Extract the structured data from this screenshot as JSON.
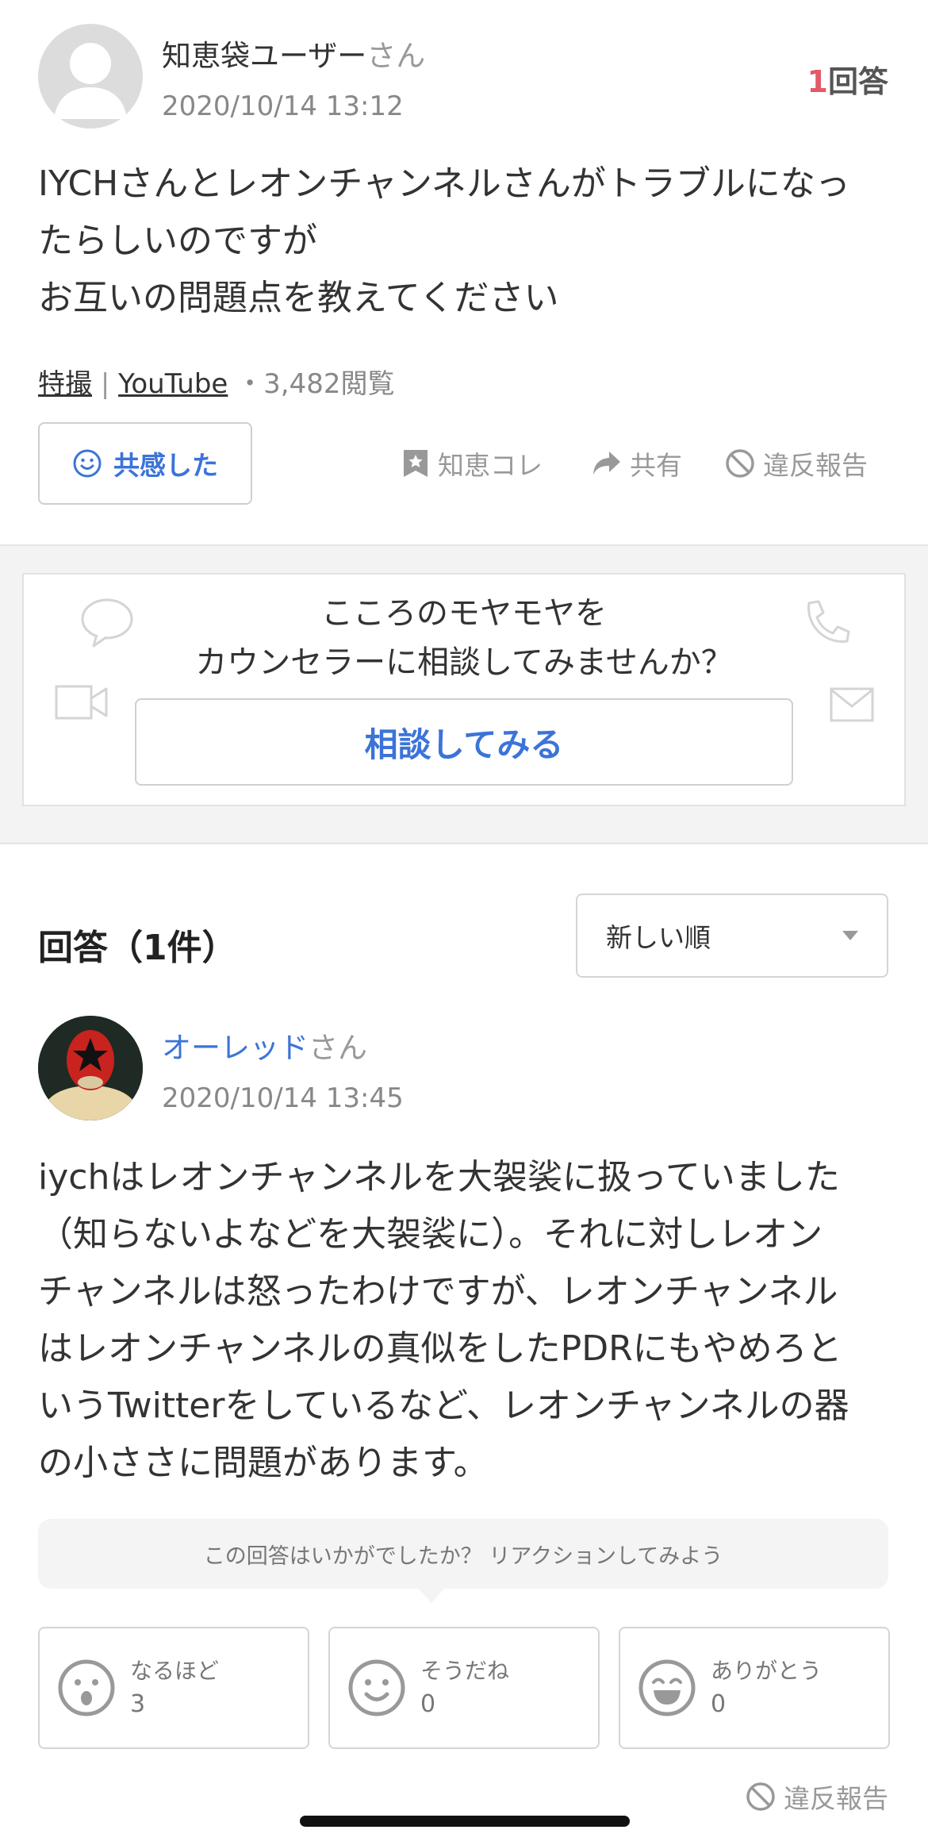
{
  "question": {
    "user_name": "知恵袋ユーザー",
    "user_suffix": "さん",
    "date": "2020/10/14 13:12",
    "answer_count_num": "1",
    "answer_count_label": "回答",
    "lines": [
      "IYCHさんとレオンチャンネルさんがトラブルになっ",
      "たらしいのですが",
      "お互いの問題点を教えてください"
    ],
    "category1": "特撮",
    "separator": "|",
    "category2": "YouTube",
    "views": "・3,482閲覧",
    "empathy_label": "共感した",
    "actions": {
      "save": "知恵コレ",
      "share": "共有",
      "report": "違反報告"
    }
  },
  "counsel": {
    "line1": "こころのモヤモヤを",
    "line2": "カウンセラーに相談してみませんか？",
    "button": "相談してみる"
  },
  "answers": {
    "heading": "回答（1件）",
    "sort_selected": "新しい順",
    "item": {
      "user_name": "オーレッド",
      "user_suffix": "さん",
      "date": "2020/10/14 13:45",
      "lines": [
        "iychはレオンチャンネルを大袈裟に扱っていました",
        "（知らないよなどを大袈裟に）。それに対しレオン",
        "チャンネルは怒ったわけですが、レオンチャンネル",
        "はレオンチャンネルの真似をしたPDRにもやめろと",
        "いうTwitterをしているなど、レオンチャンネルの器",
        "の小ささに問題があります。"
      ],
      "reaction_prompt": "この回答はいかがでしたか？ リアクションしてみよう",
      "reactions": [
        {
          "label": "なるほど",
          "count": "3",
          "icon": "surprised-face-icon"
        },
        {
          "label": "そうだね",
          "count": "0",
          "icon": "smile-face-icon"
        },
        {
          "label": "ありがとう",
          "count": "0",
          "icon": "grin-face-icon"
        }
      ],
      "report": "違反報告"
    }
  },
  "colors": {
    "accent_blue": "#3b73d9",
    "count_red": "#e35a68",
    "muted": "#999999"
  }
}
